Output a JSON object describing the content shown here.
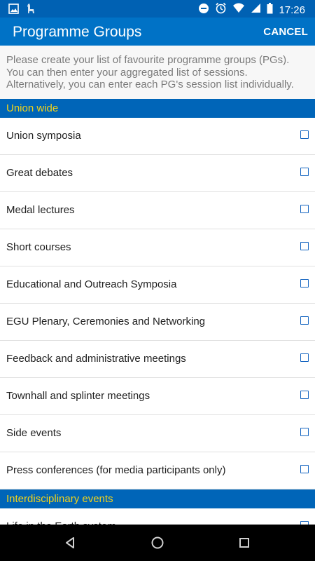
{
  "status_bar": {
    "time": "17:26",
    "left_icons": [
      "image-icon",
      "alpaca-icon"
    ],
    "right_icons": [
      "do-not-disturb-icon",
      "alarm-icon",
      "wifi-icon",
      "signal-icon",
      "battery-icon"
    ]
  },
  "app_bar": {
    "title": "Programme Groups",
    "cancel_label": "CANCEL"
  },
  "intro_text": "Please create your list of favourite programme groups (PGs). You can then enter your aggregated list of sessions. Alternatively, you can enter each PG's session list individually.",
  "sections": [
    {
      "header": "Union wide",
      "items": [
        {
          "label": "Union symposia",
          "checked": false
        },
        {
          "label": "Great debates",
          "checked": false
        },
        {
          "label": "Medal lectures",
          "checked": false
        },
        {
          "label": "Short courses",
          "checked": false
        },
        {
          "label": "Educational and Outreach Symposia",
          "checked": false
        },
        {
          "label": "EGU Plenary, Ceremonies and Networking",
          "checked": false
        },
        {
          "label": "Feedback and administrative meetings",
          "checked": false
        },
        {
          "label": "Townhall and splinter meetings",
          "checked": false
        },
        {
          "label": "Side events",
          "checked": false
        },
        {
          "label": "Press conferences (for media participants only)",
          "checked": false
        }
      ]
    },
    {
      "header": "Interdisciplinary events",
      "items": [
        {
          "label": "Life in the Earth system",
          "checked": false
        }
      ]
    }
  ],
  "nav_bar": {
    "buttons": [
      "back-icon",
      "home-icon",
      "recents-icon"
    ]
  },
  "colors": {
    "status_bar": "#0061b3",
    "app_bar": "#0072c6",
    "section_header_bg": "#0065b8",
    "section_header_text": "#f1d21a",
    "checkbox": "#1565c0"
  }
}
